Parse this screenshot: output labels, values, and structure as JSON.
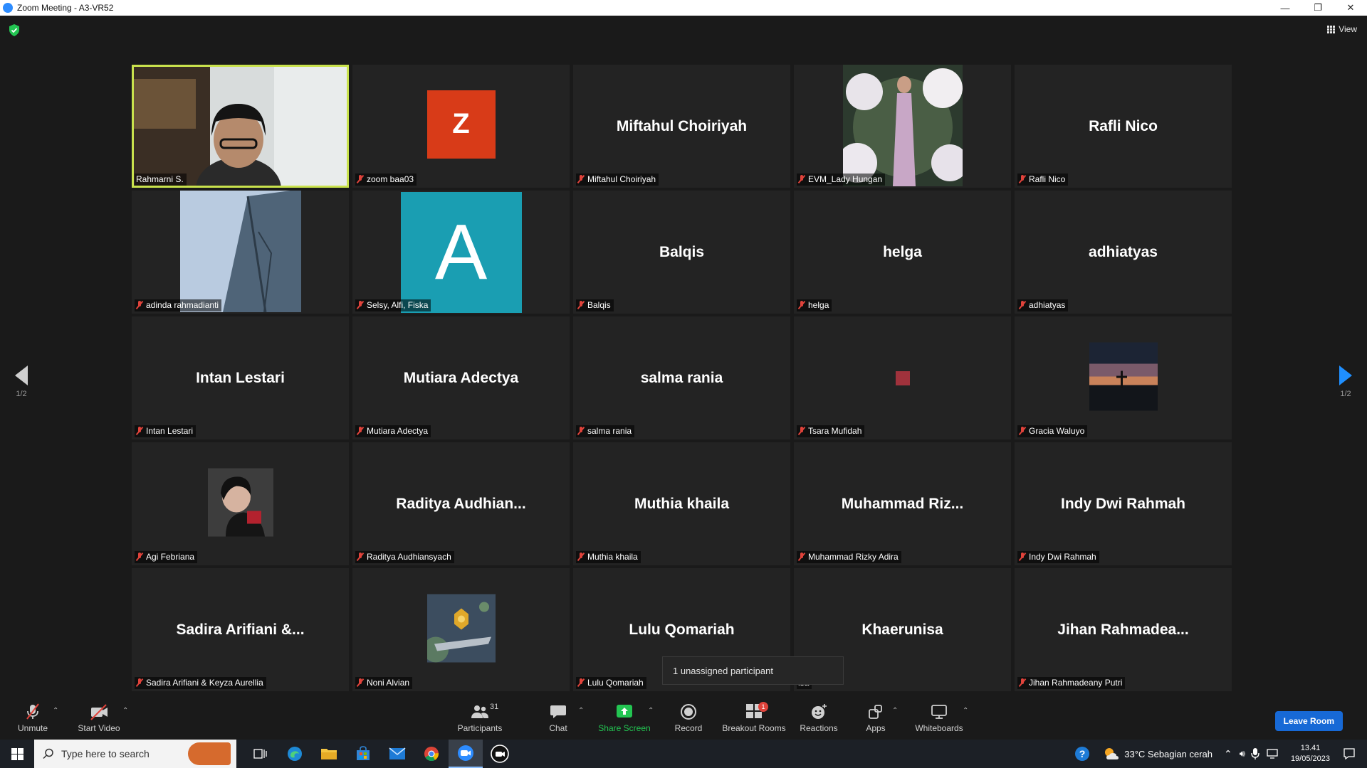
{
  "window": {
    "title": "Zoom Meeting - A3-VR52",
    "minimize": "—",
    "restore": "❐",
    "close": "✕"
  },
  "meeting": {
    "view_label": "View",
    "page_indicator_left": "1/2",
    "page_indicator_right": "1/2",
    "tooltip": "1 unassigned participant"
  },
  "tiles": [
    {
      "label": "Rahmarni S.",
      "display": "video",
      "muted": false,
      "active": true
    },
    {
      "label": "zoom baa03",
      "display": "avatar-z",
      "avatar_letter": "Z",
      "muted": true
    },
    {
      "label": "Miftahul Choiriyah",
      "display": "name",
      "big_name": "Miftahul Choiriyah",
      "muted": true
    },
    {
      "label": "EVM_Lady Hungan",
      "display": "photo-garden",
      "muted": true
    },
    {
      "label": "Rafli Nico",
      "display": "name",
      "big_name": "Rafli Nico",
      "muted": true
    },
    {
      "label": "adinda rahmadianti",
      "display": "photo-building",
      "muted": true
    },
    {
      "label": "Selsy, Alfi, Fiska",
      "display": "avatar-a",
      "avatar_letter": "A",
      "muted": true
    },
    {
      "label": "Balqis",
      "display": "name",
      "big_name": "Balqis",
      "muted": true
    },
    {
      "label": "helga",
      "display": "name",
      "big_name": "helga",
      "muted": true
    },
    {
      "label": "adhiatyas",
      "display": "name",
      "big_name": "adhiatyas",
      "muted": true
    },
    {
      "label": "Intan Lestari",
      "display": "name",
      "big_name": "Intan Lestari",
      "muted": true
    },
    {
      "label": "Mutiara Adectya",
      "display": "name",
      "big_name": "Mutiara Adectya",
      "muted": true
    },
    {
      "label": "salma rania",
      "display": "name",
      "big_name": "salma rania",
      "muted": true
    },
    {
      "label": "Tsara Mufidah",
      "display": "square",
      "muted": true
    },
    {
      "label": "Gracia Waluyo",
      "display": "photo-sunset",
      "muted": true
    },
    {
      "label": "Agi Febriana",
      "display": "photo-portrait",
      "muted": true
    },
    {
      "label": "Raditya Audhiansyach",
      "display": "name",
      "big_name": "Raditya  Audhian...",
      "muted": true
    },
    {
      "label": "Muthia khaila",
      "display": "name",
      "big_name": "Muthia khaila",
      "muted": true
    },
    {
      "label": "Muhammad Rizky Adira",
      "display": "name",
      "big_name": "Muhammad  Riz...",
      "muted": true
    },
    {
      "label": "Indy Dwi Rahmah",
      "display": "name",
      "big_name": "Indy Dwi Rahmah",
      "muted": true
    },
    {
      "label": "Sadira Arifiani & Keyza Aurellia",
      "display": "name",
      "big_name": "Sadira  Arifiani  &...",
      "muted": true
    },
    {
      "label": "Noni Alvian",
      "display": "photo-space",
      "muted": true
    },
    {
      "label": "Lulu Qomariah",
      "display": "name",
      "big_name": "Lulu Qomariah",
      "muted": true
    },
    {
      "label": "isa",
      "display": "name",
      "big_name": "Khaerunisa",
      "muted": false
    },
    {
      "label": "Jihan Rahmadeany Putri",
      "display": "name",
      "big_name": "Jihan  Rahmadea...",
      "muted": true
    }
  ],
  "toolbar": {
    "unmute": "Unmute",
    "start_video": "Start Video",
    "participants": "Participants",
    "participants_count": "31",
    "chat": "Chat",
    "share_screen": "Share Screen",
    "record": "Record",
    "breakout_rooms": "Breakout Rooms",
    "breakout_badge": "1",
    "reactions": "Reactions",
    "apps": "Apps",
    "whiteboards": "Whiteboards",
    "leave": "Leave Room"
  },
  "taskbar": {
    "search_placeholder": "Type here to search",
    "weather": "33°C  Sebagian cerah",
    "time": "13.41",
    "date": "19/05/2023"
  },
  "colors": {
    "accent": "#1769d6",
    "active_outline": "#c9e24d",
    "share_green": "#23c552",
    "muted_red": "#e0433b"
  }
}
